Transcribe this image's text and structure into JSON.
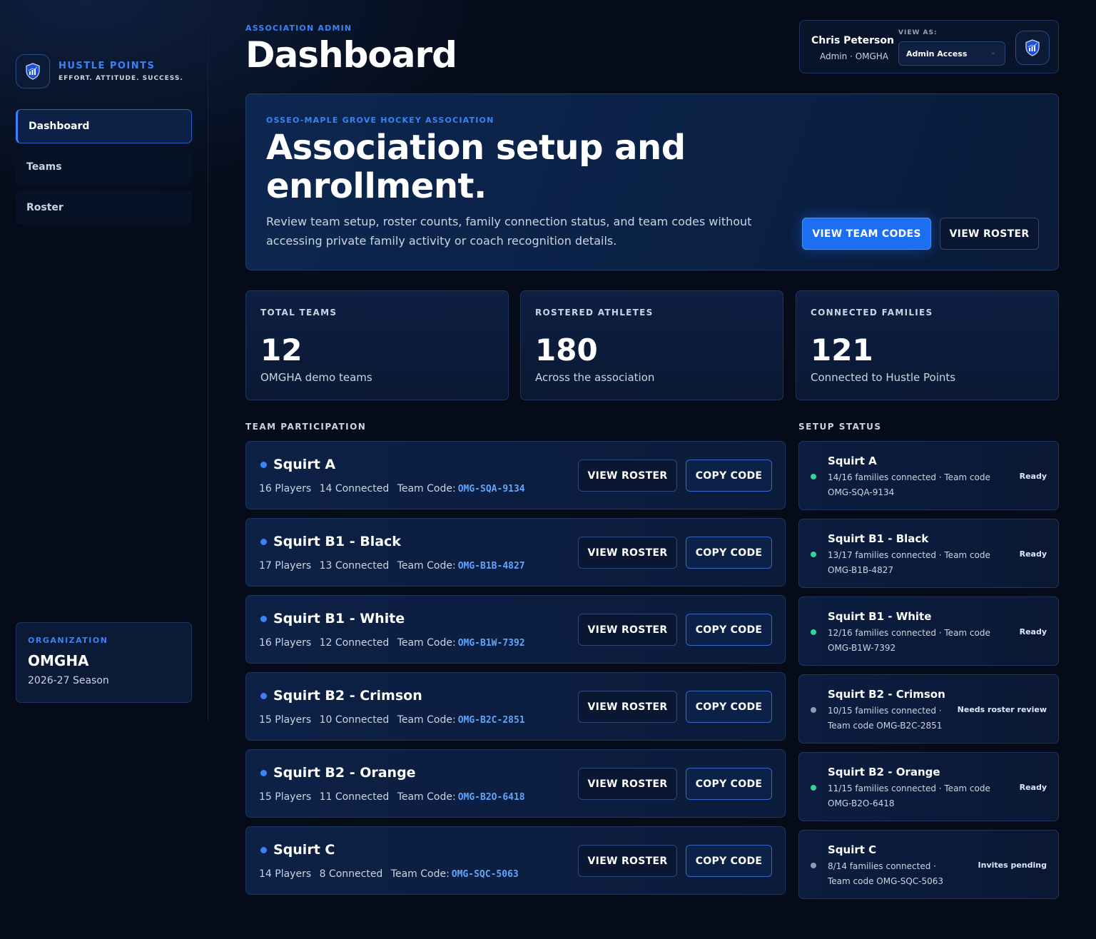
{
  "brand": {
    "name": "HUSTLE POINTS",
    "tagline": "EFFORT. ATTITUDE. SUCCESS.",
    "logo_icon": "shield-chart-icon"
  },
  "nav": [
    {
      "label": "Dashboard",
      "active": true
    },
    {
      "label": "Teams",
      "active": false
    },
    {
      "label": "Roster",
      "active": false
    }
  ],
  "organization": {
    "label": "ORGANIZATION",
    "name": "OMGHA",
    "season": "2026-27 Season"
  },
  "header": {
    "eyebrow": "ASSOCIATION ADMIN",
    "title": "Dashboard"
  },
  "user": {
    "name": "Chris Peterson",
    "role": "Admin · OMGHA",
    "view_as_label": "VIEW AS:",
    "view_as_value": "Admin Access"
  },
  "hero": {
    "eyebrow": "OSSEO-MAPLE GROVE HOCKEY ASSOCIATION",
    "title": "Association setup and enrollment.",
    "description": "Review team setup, roster counts, family connection status, and team codes without accessing private family activity or coach recognition details.",
    "primary_button": "VIEW TEAM CODES",
    "secondary_button": "VIEW ROSTER"
  },
  "stats": [
    {
      "label": "TOTAL TEAMS",
      "value": "12",
      "sub": "OMGHA demo teams"
    },
    {
      "label": "ROSTERED ATHLETES",
      "value": "180",
      "sub": "Across the association"
    },
    {
      "label": "CONNECTED FAMILIES",
      "value": "121",
      "sub": "Connected to Hustle Points"
    }
  ],
  "participation": {
    "title": "TEAM PARTICIPATION",
    "code_prefix": "Team Code:",
    "roster_button": "VIEW ROSTER",
    "copy_button": "COPY CODE",
    "teams": [
      {
        "name": "Squirt A",
        "players": "16 Players",
        "connected": "14 Connected",
        "code": "OMG-SQA-9134"
      },
      {
        "name": "Squirt B1 - Black",
        "players": "17 Players",
        "connected": "13 Connected",
        "code": "OMG-B1B-4827"
      },
      {
        "name": "Squirt B1 - White",
        "players": "16 Players",
        "connected": "12 Connected",
        "code": "OMG-B1W-7392"
      },
      {
        "name": "Squirt B2 - Crimson",
        "players": "15 Players",
        "connected": "10 Connected",
        "code": "OMG-B2C-2851"
      },
      {
        "name": "Squirt B2 - Orange",
        "players": "15 Players",
        "connected": "11 Connected",
        "code": "OMG-B2O-6418"
      },
      {
        "name": "Squirt C",
        "players": "14 Players",
        "connected": "8 Connected",
        "code": "OMG-SQC-5063"
      }
    ]
  },
  "setup_status": {
    "title": "SETUP STATUS",
    "colors": {
      "ready": "#34d399",
      "pending": "#8b9bb8"
    },
    "items": [
      {
        "name": "Squirt A",
        "detail": "14/16 families connected · Team code OMG-SQA-9134",
        "status": "Ready",
        "state": "ready"
      },
      {
        "name": "Squirt B1 - Black",
        "detail": "13/17 families connected · Team code OMG-B1B-4827",
        "status": "Ready",
        "state": "ready"
      },
      {
        "name": "Squirt B1 - White",
        "detail": "12/16 families connected · Team code OMG-B1W-7392",
        "status": "Ready",
        "state": "ready"
      },
      {
        "name": "Squirt B2 - Crimson",
        "detail": "10/15 families connected · Team code OMG-B2C-2851",
        "status": "Needs roster review",
        "state": "pending"
      },
      {
        "name": "Squirt B2 - Orange",
        "detail": "11/15 families connected · Team code OMG-B2O-6418",
        "status": "Ready",
        "state": "ready"
      },
      {
        "name": "Squirt C",
        "detail": "8/14 families connected · Team code OMG-SQC-5063",
        "status": "Invites pending",
        "state": "pending"
      }
    ]
  }
}
